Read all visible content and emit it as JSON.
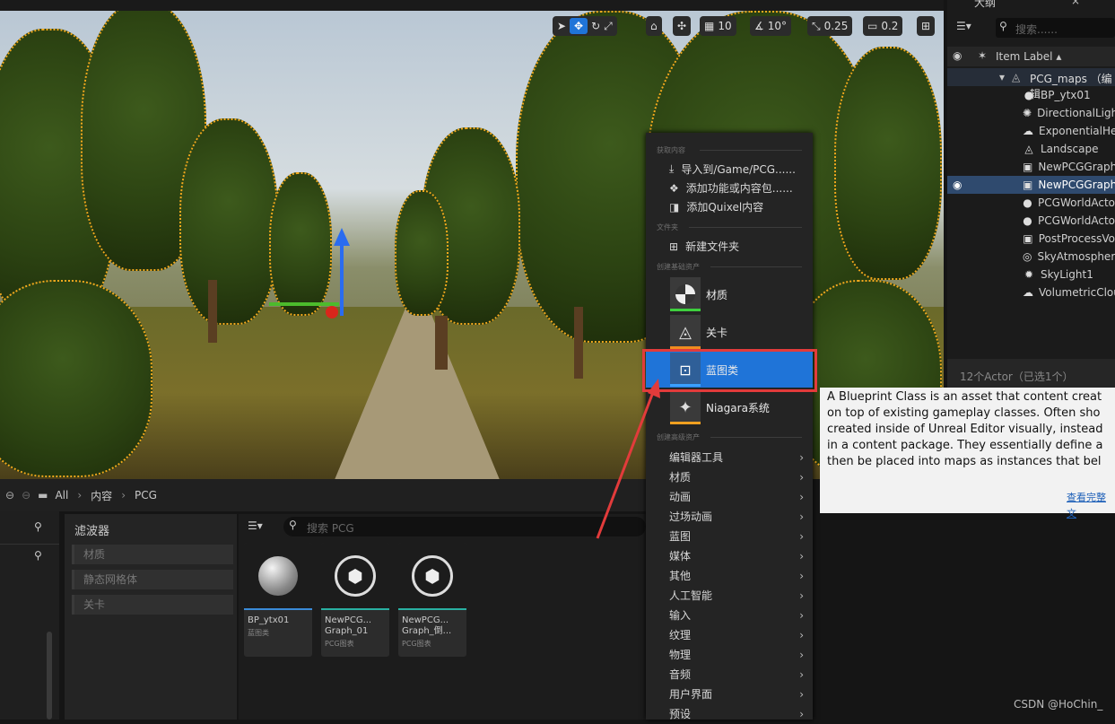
{
  "viewport": {
    "toolbar": {
      "grid_snap": "10",
      "rotation_snap": "10°",
      "scale_snap": "0.25",
      "camera_speed": "0.2"
    }
  },
  "outliner": {
    "tab_label": "大纲",
    "search_placeholder": "搜索......",
    "column_header": "Item Label ▴",
    "root": "PCG_maps （编辑",
    "items": [
      {
        "label": "BP_ytx01",
        "icon": "actor-sphere-icon"
      },
      {
        "label": "DirectionalLight",
        "icon": "sun-icon"
      },
      {
        "label": "ExponentialHei",
        "icon": "fog-icon"
      },
      {
        "label": "Landscape",
        "icon": "landscape-icon"
      },
      {
        "label": "NewPCGGraph",
        "icon": "cube-graph-icon"
      },
      {
        "label": "NewPCGGraph",
        "icon": "cube-graph-icon"
      },
      {
        "label": "PCGWorldActo",
        "icon": "actor-sphere-icon"
      },
      {
        "label": "PCGWorldActo",
        "icon": "actor-sphere-icon"
      },
      {
        "label": "PostProcessVo",
        "icon": "cube-graph-icon"
      },
      {
        "label": "SkyAtmosphere",
        "icon": "atmosphere-icon"
      },
      {
        "label": "SkyLight1",
        "icon": "skylight-icon"
      },
      {
        "label": "VolumetricClou",
        "icon": "cloud-icon"
      }
    ],
    "footer": "12个Actor（已选1个）"
  },
  "content_browser": {
    "breadcrumb": [
      "All",
      "内容",
      "PCG"
    ],
    "filters_title": "滤波器",
    "filters": [
      "材质",
      "静态网格体",
      "关卡"
    ],
    "search_placeholder": "搜索 PCG",
    "assets": [
      {
        "name": "BP_ytx01",
        "type": "蓝图类"
      },
      {
        "name": "NewPCG... Graph_01",
        "type": "PCG图表"
      },
      {
        "name": "NewPCG... Graph_倒...",
        "type": "PCG图表"
      }
    ]
  },
  "context_menu": {
    "section_get": "获取内容",
    "import": "导入到/Game/PCG......",
    "add_feature": "添加功能或内容包......",
    "add_quixel": "添加Quixel内容",
    "section_folder": "文件夹",
    "new_folder": "新建文件夹",
    "section_basic": "创建基础资产",
    "basic_assets": [
      {
        "label": "材质",
        "color": "#3ecf3e"
      },
      {
        "label": "关卡",
        "color": "#f08c1e"
      },
      {
        "label": "蓝图类",
        "color": "#3aa0ff"
      },
      {
        "label": "Niagara系统",
        "color": "#f0a020"
      }
    ],
    "section_advanced": "创建高级资产",
    "submenus": [
      "编辑器工具",
      "材质",
      "动画",
      "过场动画",
      "蓝图",
      "媒体",
      "其他",
      "人工智能",
      "输入",
      "纹理",
      "物理",
      "音频",
      "用户界面",
      "预设"
    ]
  },
  "tooltip": {
    "lines": [
      "A Blueprint Class is an asset that content creat",
      "on top of existing gameplay classes. Often sho",
      "created inside of Unreal Editor visually, instead",
      "in a content package. They essentially define a",
      "then be placed into maps as instances that bel"
    ],
    "link": "查看完整文"
  },
  "watermark": "CSDN @HoChin_",
  "colors": {
    "selection": "#1f74d8",
    "highlight_box": "#e23b3b"
  }
}
